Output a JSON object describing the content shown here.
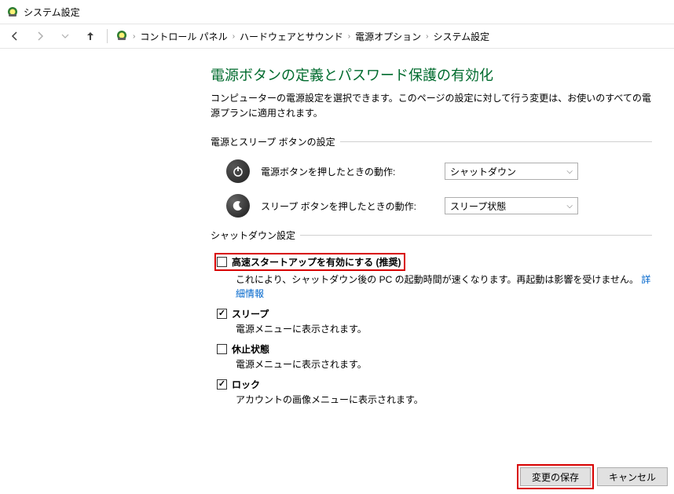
{
  "window": {
    "title": "システム設定"
  },
  "breadcrumb": {
    "items": [
      "コントロール パネル",
      "ハードウェアとサウンド",
      "電源オプション",
      "システム設定"
    ]
  },
  "page": {
    "title": "電源ボタンの定義とパスワード保護の有効化",
    "description": "コンピューターの電源設定を選択できます。このページの設定に対して行う変更は、お使いのすべての電源プランに適用されます。"
  },
  "sections": {
    "power_sleep": {
      "header": "電源とスリープ ボタンの設定",
      "rows": {
        "power_button": {
          "label": "電源ボタンを押したときの動作:",
          "value": "シャットダウン"
        },
        "sleep_button": {
          "label": "スリープ ボタンを押したときの動作:",
          "value": "スリープ状態"
        }
      }
    },
    "shutdown": {
      "header": "シャットダウン設定",
      "options": {
        "fast_startup": {
          "label": "高速スタートアップを有効にする (推奨)",
          "checked": false,
          "desc_prefix": "これにより、シャットダウン後の PC の起動時間が速くなります。再起動は影響を受けません。",
          "desc_link": "詳細情報"
        },
        "sleep": {
          "label": "スリープ",
          "checked": true,
          "desc": "電源メニューに表示されます。"
        },
        "hibernate": {
          "label": "休止状態",
          "checked": false,
          "desc": "電源メニューに表示されます。"
        },
        "lock": {
          "label": "ロック",
          "checked": true,
          "desc": "アカウントの画像メニューに表示されます。"
        }
      }
    }
  },
  "footer": {
    "save": "変更の保存",
    "cancel": "キャンセル"
  }
}
